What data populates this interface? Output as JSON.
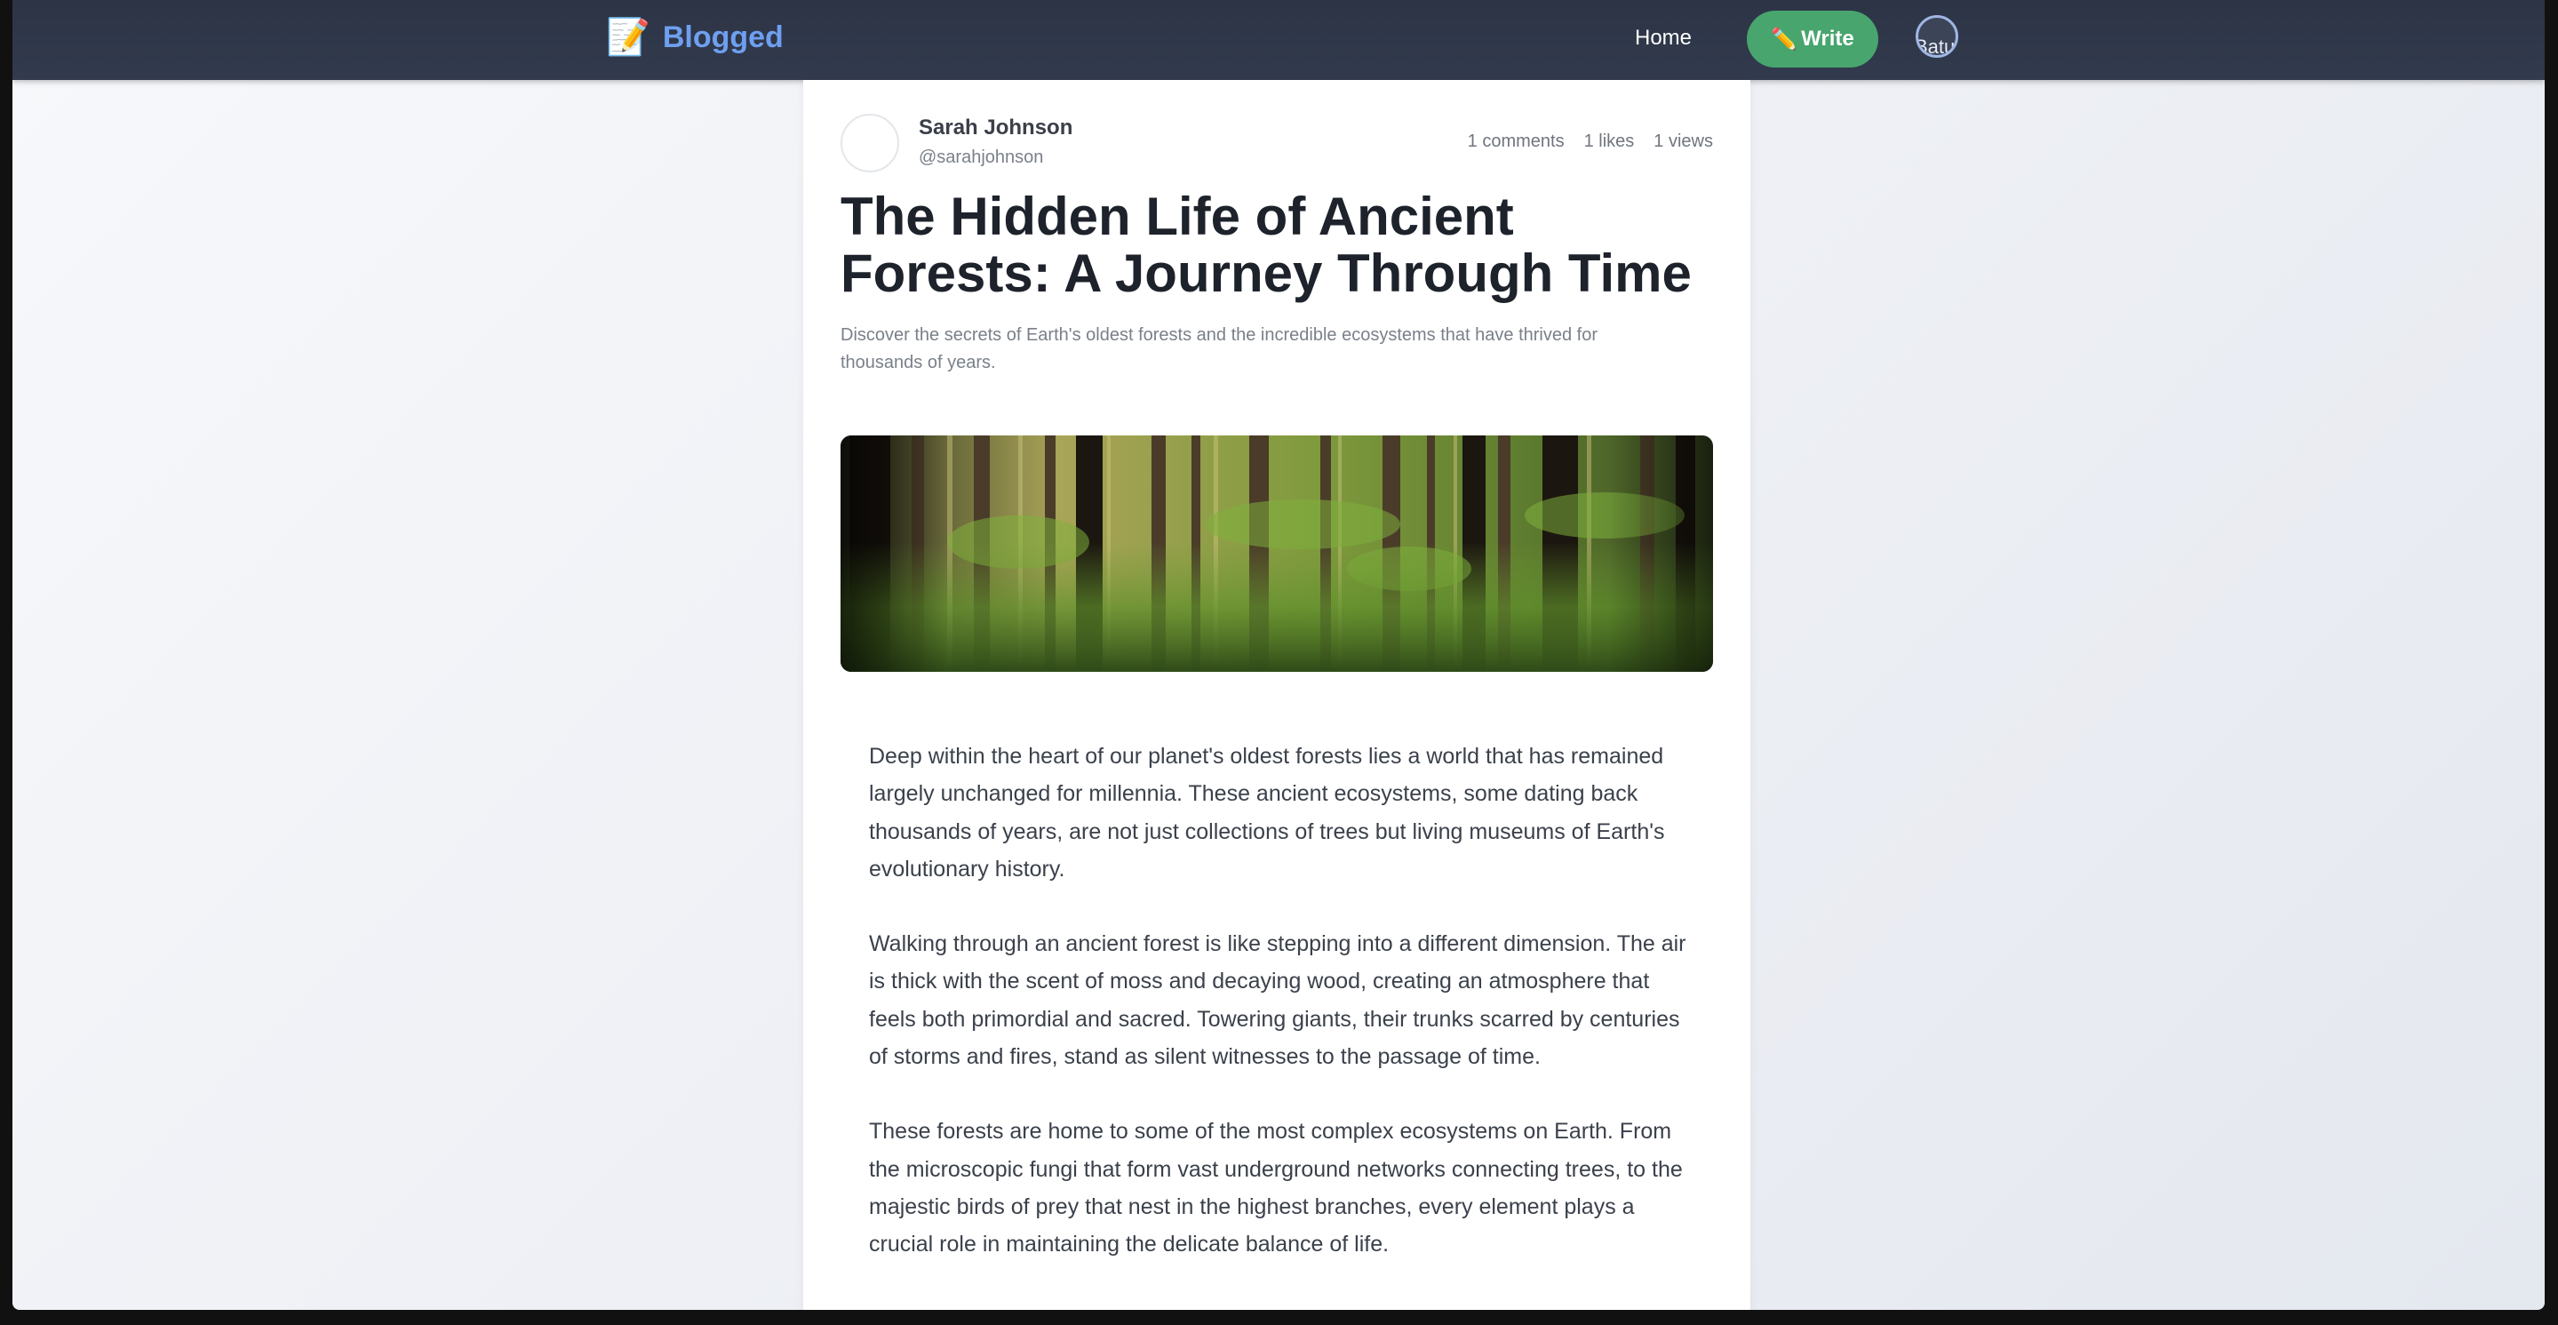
{
  "header": {
    "brand_icon": "📝",
    "brand_name": "Blogged",
    "nav_home": "Home",
    "write_icon": "✏️",
    "write_label": "Write",
    "avatar_alt": "Batu"
  },
  "post": {
    "author": {
      "name": "Sarah Johnson",
      "handle": "@sarahjohnson"
    },
    "stats": {
      "comments": "1 comments",
      "likes": "1 likes",
      "views": "1 views"
    },
    "title": "The Hidden Life of Ancient Forests: A Journey Through Time",
    "subtitle": "Discover the secrets of Earth's oldest forests and the incredible ecosystems that have thrived for thousands of years.",
    "paragraphs": [
      "Deep within the heart of our planet's oldest forests lies a world that has remained largely unchanged for millennia. These ancient ecosystems, some dating back thousands of years, are not just collections of trees but living museums of Earth's evolutionary history.",
      "Walking through an ancient forest is like stepping into a different dimension. The air is thick with the scent of moss and decaying wood, creating an atmosphere that feels both primordial and sacred. Towering giants, their trunks scarred by centuries of storms and fires, stand as silent witnesses to the passage of time.",
      "These forests are home to some of the most complex ecosystems on Earth. From the microscopic fungi that form vast underground networks connecting trees, to the majestic birds of prey that nest in the highest branches, every element plays a crucial role in maintaining the delicate balance of life."
    ]
  },
  "colors": {
    "topbar": "#2f3749",
    "brand": "#6f9ff0",
    "write_button": "#48a56e",
    "title": "#1d222b"
  }
}
